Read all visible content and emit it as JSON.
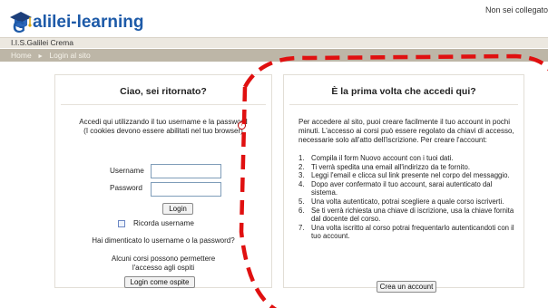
{
  "header": {
    "logo_text": "alilei-learning",
    "login_info": "Non sei collegato"
  },
  "site_bar": {
    "label": "I.I.S.Galilei Crema"
  },
  "breadcrumb": {
    "home": "Home",
    "separator": "►",
    "current": "Login al sito"
  },
  "login_panel": {
    "title": "Ciao, sei ritornato?",
    "intro_line1": "Accedi qui utilizzando il tuo username e la password",
    "intro_line2": "(I cookies devono essere abilitati nel tuo browser)",
    "username_label": "Username",
    "password_label": "Password",
    "username_value": "",
    "password_value": "",
    "login_button": "Login",
    "remember_label": "Ricorda username",
    "forgot_text": "Hai dimenticato lo username o la password?",
    "guest_line1": "Alcuni corsi possono permettere",
    "guest_line2": "l'accesso agli ospiti",
    "guest_button": "Login come ospite"
  },
  "signup_panel": {
    "title": "È la prima volta che accedi qui?",
    "intro": "Per accedere al sito, puoi creare facilmente il tuo account in pochi minuti. L'accesso ai corsi può essere regolato da chiavi di accesso, necessarie solo all'atto dell'iscrizione. Per creare l'account:",
    "steps": [
      {
        "num": "1.",
        "text": "Compila il form Nuovo account con i tuoi dati."
      },
      {
        "num": "2.",
        "text": "Ti verrà spedita una email all'indirizzo da te fornito."
      },
      {
        "num": "3.",
        "text": "Leggi l'email e clicca sul link presente nel corpo del messaggio."
      },
      {
        "num": "4.",
        "text": "Dopo aver confermato il tuo account, sarai autenticato dal sistema."
      },
      {
        "num": "5.",
        "text": "Una volta autenticato, potrai scegliere a quale corso iscriverti."
      },
      {
        "num": "6.",
        "text": "Se ti verrà richiesta una chiave di iscrizione, usa la chiave fornita dal docente del corso."
      },
      {
        "num": "7.",
        "text": "Una volta iscritto al corso potrai frequentarlo autenticandoti con il tuo account."
      }
    ],
    "create_button": "Crea un account"
  },
  "colors": {
    "logo_blue": "#1d5aa8",
    "nav_bar": "#bdb6a7",
    "annotation_red": "#e01010"
  },
  "icons": {
    "logo": "graduation-cap-logo-icon",
    "help": "help-icon",
    "breadcrumb_separator": "triangle-right-icon"
  }
}
